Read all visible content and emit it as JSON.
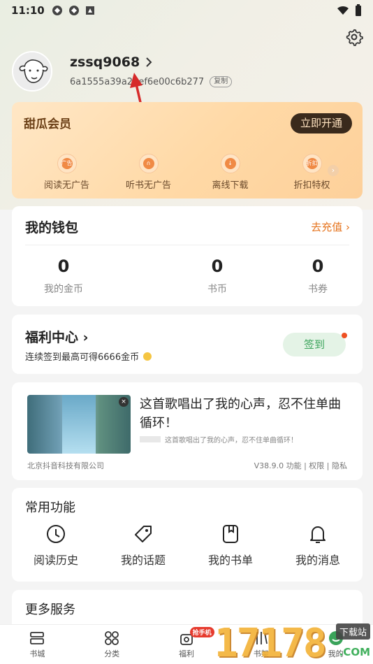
{
  "status": {
    "time": "11:10"
  },
  "profile": {
    "username": "zssq9068",
    "user_id": "6a1555a39a28ef6e00c6b277",
    "copy_label": "复制"
  },
  "vip": {
    "title": "甜瓜会员",
    "button": "立即开通",
    "perks": [
      {
        "label": "阅读无广告",
        "icon_text": "广告"
      },
      {
        "label": "听书无广告",
        "icon_text": ""
      },
      {
        "label": "离线下载",
        "icon_text": ""
      },
      {
        "label": "折扣特权",
        "icon_text": "折扣"
      }
    ]
  },
  "wallet": {
    "title": "我的钱包",
    "recharge": "去充值",
    "stats": [
      {
        "value": "0",
        "label": "我的金币"
      },
      {
        "value": "0",
        "label": "书币"
      },
      {
        "value": "0",
        "label": "书券"
      }
    ]
  },
  "welfare": {
    "title": "福利中心",
    "desc": "连续签到最高可得6666金币",
    "checkin": "签到"
  },
  "ad": {
    "headline": "这首歌唱出了我的心声，忍不住单曲循环！",
    "sub": "这首歌唱出了我的心声，忍不住单曲循环！",
    "company": "北京抖音科技有限公司",
    "meta": "V38.9.0  功能 | 权限 | 隐私"
  },
  "common": {
    "title": "常用功能",
    "items": [
      {
        "label": "阅读历史",
        "icon": "clock-icon"
      },
      {
        "label": "我的话题",
        "icon": "tag-icon"
      },
      {
        "label": "我的书单",
        "icon": "booklist-icon"
      },
      {
        "label": "我的消息",
        "icon": "bell-icon"
      }
    ]
  },
  "more": {
    "title": "更多服务"
  },
  "tabs": [
    {
      "label": "书城"
    },
    {
      "label": "分类"
    },
    {
      "label": "福利",
      "badge": "抢手机"
    },
    {
      "label": "书架"
    },
    {
      "label": "我的"
    }
  ],
  "watermark": {
    "digits": "17178",
    "site": "下载站",
    "domain": ".COM"
  },
  "colors": {
    "accent": "#e6741e",
    "green": "#3aa35a",
    "vip_dark": "#3a2a1c"
  }
}
